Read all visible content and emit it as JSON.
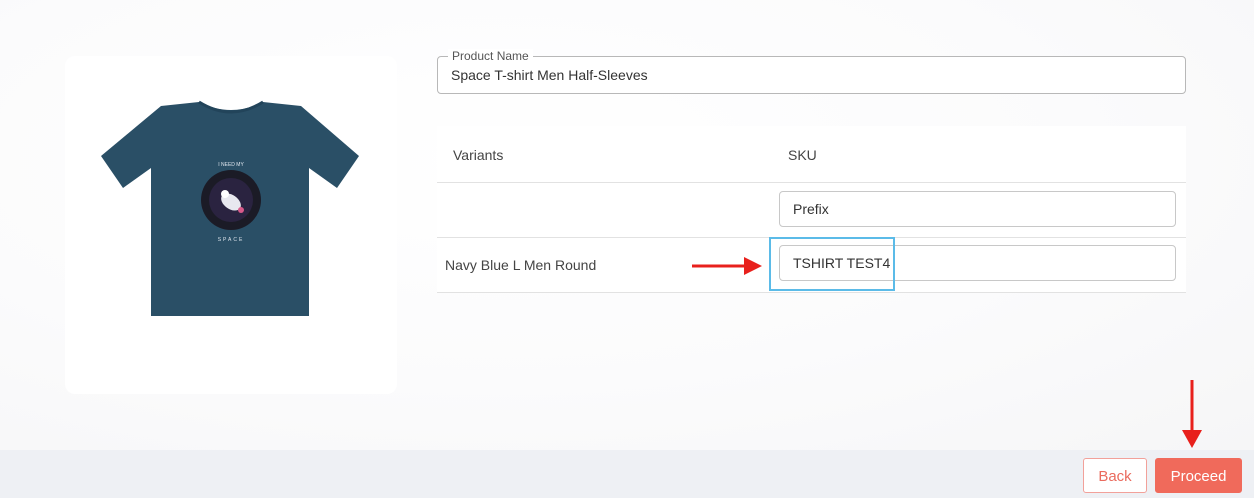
{
  "product": {
    "image_alt": "navy t-shirt with space astronaut graphic",
    "print_text_top": "I NEED MY",
    "print_text_bottom": "SPACE",
    "name_label": "Product Name",
    "name_value": "Space T-shirt Men Half-Sleeves"
  },
  "table": {
    "headers": [
      "Variants",
      "SKU"
    ],
    "prefix_placeholder": "Prefix",
    "rows": [
      {
        "variant": "Navy Blue L Men Round",
        "sku": "TSHIRT TEST4"
      }
    ]
  },
  "footer": {
    "back_label": "Back",
    "proceed_label": "Proceed"
  },
  "colors": {
    "accent": "#f06a5b",
    "focus": "#5bbbe8",
    "annotation_arrow": "#e8201c",
    "shirt": "#2a4f66"
  }
}
